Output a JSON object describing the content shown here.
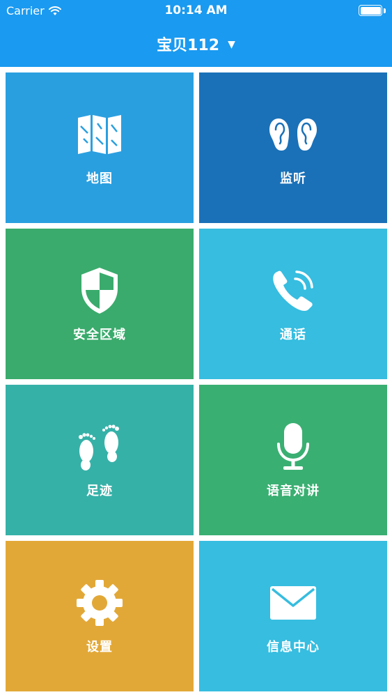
{
  "status_bar": {
    "carrier": "Carrier",
    "time": "10:14 AM"
  },
  "nav": {
    "title": "宝贝112",
    "dropdown_caret": "▼"
  },
  "tiles": [
    {
      "label": "地图",
      "icon": "map-icon",
      "color": "#2a9fe0"
    },
    {
      "label": "监听",
      "icon": "ears-icon",
      "color": "#1a71b8"
    },
    {
      "label": "安全区域",
      "icon": "shield-icon",
      "color": "#3aab6c"
    },
    {
      "label": "通话",
      "icon": "phone-icon",
      "color": "#36bde0"
    },
    {
      "label": "足迹",
      "icon": "footprints-icon",
      "color": "#36b1a8"
    },
    {
      "label": "语音对讲",
      "icon": "microphone-icon",
      "color": "#3aaf72"
    },
    {
      "label": "设置",
      "icon": "gear-icon",
      "color": "#e2a837"
    },
    {
      "label": "信息中心",
      "icon": "mail-icon",
      "color": "#36bde0"
    }
  ],
  "colors": {
    "header": "#1a9af0"
  }
}
